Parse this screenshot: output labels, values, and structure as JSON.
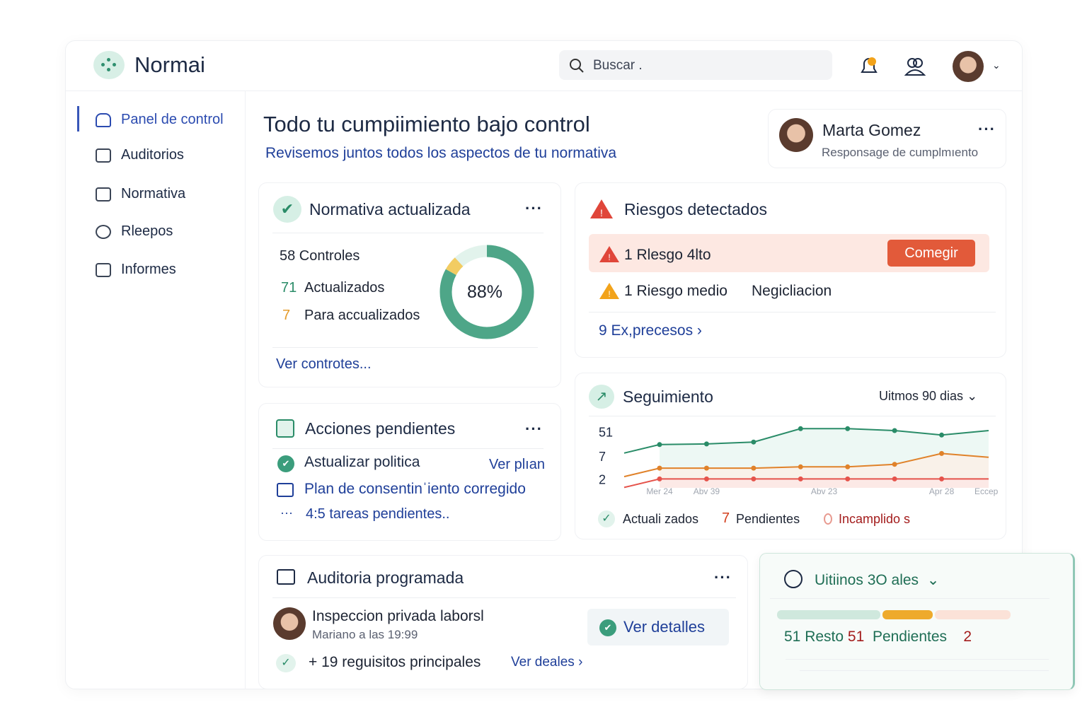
{
  "header": {
    "brand": "Normai",
    "search_placeholder": "Buscar ."
  },
  "sidebar": {
    "items": [
      {
        "label": "Panel de control",
        "active": true
      },
      {
        "label": "Auditorios"
      },
      {
        "label": "Normativa"
      },
      {
        "label": "Rleepos"
      },
      {
        "label": "Informes"
      }
    ]
  },
  "hero": {
    "title": "Todo tu cumpiimiento bajo control",
    "subtitle": "Revisemos juntos todos los aspectos de tu normativa"
  },
  "user": {
    "name": "Marta Gomez",
    "role": "Responsage de cumplmıento"
  },
  "normativa": {
    "title": "Normativa actualizada",
    "controls": "58 Controles",
    "updated_num": "71",
    "updated_label": "Actualizados",
    "pending_num": "7",
    "pending_label": "Para accualizados",
    "percent_label": "88%",
    "percent": 88,
    "pending_fraction": 5,
    "link": "Ver controtes..."
  },
  "riesgos": {
    "title": "Riesgos detectados",
    "high": "1 Rlesgo 4lto",
    "fix_button": "Comegir",
    "medium": "1 Riesgo medio",
    "medium_tag": "Negicliacion",
    "expired": "9 Ex,precesos"
  },
  "acciones": {
    "title": "Acciones pendientes",
    "items": [
      {
        "label": "Astualizar politica",
        "link": "Ver plıan"
      },
      {
        "label": "Plan de consentinˈiento corregido"
      }
    ],
    "more": "4:5 tareas pendientes.."
  },
  "seguimiento": {
    "title": "Seguimiento",
    "range": "Uitmos 90 dias",
    "legend": [
      {
        "prefix": "",
        "label": "Actuali zados"
      },
      {
        "prefix": "7",
        "label": "Pendientes"
      },
      {
        "prefix": "",
        "label": "Incamplido s"
      }
    ]
  },
  "chart_data": {
    "type": "line",
    "ylim": [
      0,
      100
    ],
    "ytick_labels": [
      {
        "label": "51",
        "value": 87
      },
      {
        "label": "7",
        "value": 49
      },
      {
        "label": "2",
        "value": 13
      }
    ],
    "x": [
      0,
      1,
      2,
      3,
      4,
      5,
      6,
      7
    ],
    "xtick_labels": [
      {
        "label": "Mer 24",
        "at": 0
      },
      {
        "label": "Abv 39",
        "at": 1
      },
      {
        "label": "Abv 23",
        "at": 3.5
      },
      {
        "label": "Apr 28",
        "at": 6
      },
      {
        "label": "Eccepo",
        "at": 7
      }
    ],
    "series": [
      {
        "name": "Actualizados",
        "color": "#2a8c68",
        "values": [
          68,
          69,
          72,
          93,
          93,
          90,
          83,
          90
        ]
      },
      {
        "name": "Pendientes",
        "color": "#e0822a",
        "values": [
          31,
          31,
          31,
          33,
          33,
          37,
          54,
          48
        ]
      },
      {
        "name": "Incumplidos",
        "color": "#e5534b",
        "values": [
          14,
          14,
          14,
          14,
          14,
          14,
          14,
          14
        ]
      }
    ]
  },
  "auditoria": {
    "title": "Auditoria programada",
    "event": "Inspeccion privada laborsl",
    "when": "Mariano a las 19:99",
    "button": "Ver detalles",
    "reqs": "+ 19 reguisitos principales",
    "reqs_link": "Ver deales"
  },
  "resumen": {
    "range": "Uitiinos  3O ales",
    "n1": "51",
    "l1": "Resto",
    "n2": "51",
    "l2": "Pendientes",
    "n3": "2",
    "bar": {
      "done": 0.45,
      "pending": 0.22,
      "failed": 0.33
    }
  }
}
